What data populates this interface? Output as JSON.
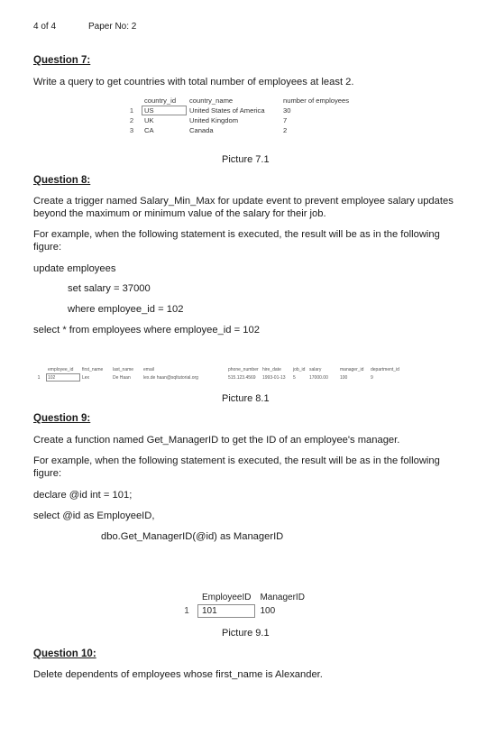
{
  "header": {
    "page": "4 of 4",
    "paper": "Paper No: 2"
  },
  "q7": {
    "title": "Question 7:",
    "text": "Write a query to get countries with total number of employees at least 2.",
    "table": {
      "columns": [
        "country_id",
        "country_name",
        "number of employees"
      ],
      "rows": [
        {
          "n": "1",
          "cells": [
            "US",
            "United States of America",
            "30"
          ]
        },
        {
          "n": "2",
          "cells": [
            "UK",
            "United Kingdom",
            "7"
          ]
        },
        {
          "n": "3",
          "cells": [
            "CA",
            "Canada",
            "2"
          ]
        }
      ]
    },
    "caption": "Picture 7.1"
  },
  "q8": {
    "title": "Question 8:",
    "text": "Create a trigger named Salary_Min_Max for update event  to prevent employee salary updates beyond the maximum or minimum value of the salary for their job.",
    "example": "For example, when the following statement is executed, the result will be as in the following figure:",
    "code1": "update employees",
    "code2": "set salary = 37000",
    "code3": "where employee_id = 102",
    "code4": "select * from employees where employee_id = 102",
    "table": {
      "columns": [
        "employee_id",
        "first_name",
        "last_name",
        "email",
        "phone_number",
        "hire_date",
        "job_id",
        "salary",
        "manager_id",
        "department_id"
      ],
      "rows": [
        {
          "n": "1",
          "cells": [
            "102",
            "Lex",
            "De Haan",
            "lex.de haan@sqltutorial.org",
            "515.123.4569",
            "1993-01-13",
            "5",
            "17000.00",
            "100",
            "9"
          ]
        }
      ]
    },
    "caption": "Picture 8.1"
  },
  "q9": {
    "title": "Question 9:",
    "text": "Create a function named Get_ManagerID to get the ID of an employee's manager.",
    "example": "For example, when the following statement is executed, the result will be as in the following figure:",
    "code1": "declare @id int = 101;",
    "code2": "select @id as EmployeeID,",
    "code3": "dbo.Get_ManagerID(@id) as ManagerID",
    "table": {
      "columns": [
        "EmployeeID",
        "ManagerID"
      ],
      "rows": [
        {
          "n": "1",
          "cells": [
            "101",
            "100"
          ]
        }
      ]
    },
    "caption": "Picture 9.1"
  },
  "q10": {
    "title": "Question 10:",
    "text": "Delete dependents of employees whose first_name is Alexander."
  }
}
